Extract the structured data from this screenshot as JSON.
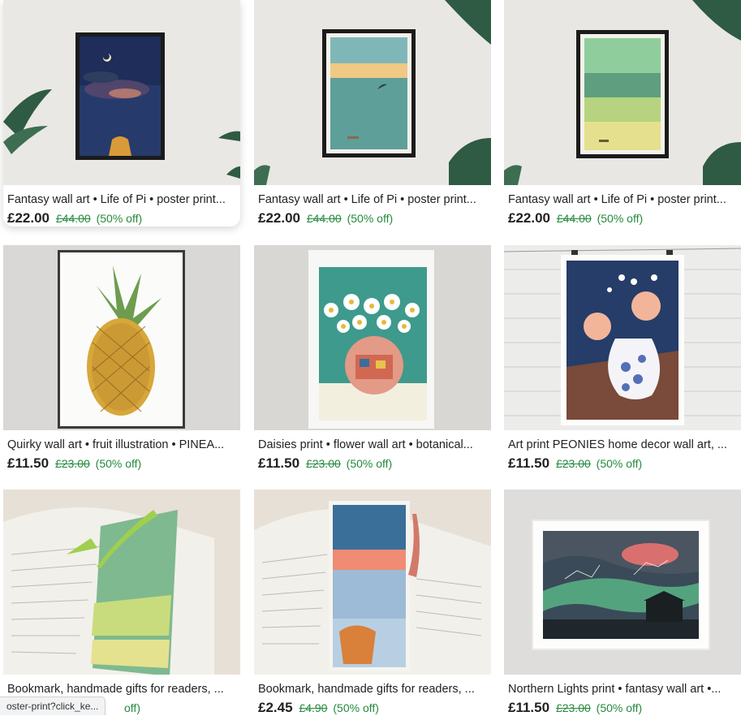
{
  "listings": [
    {
      "title": "Fantasy wall art • Life of Pi • poster print...",
      "price": "£22.00",
      "original_price": "£44.00",
      "discount": "(50% off)"
    },
    {
      "title": "Fantasy wall art • Life of Pi • poster print...",
      "price": "£22.00",
      "original_price": "£44.00",
      "discount": "(50% off)"
    },
    {
      "title": "Fantasy wall art • Life of Pi • poster print...",
      "price": "£22.00",
      "original_price": "£44.00",
      "discount": "(50% off)"
    },
    {
      "title": "Quirky wall art • fruit illustration • PINEA...",
      "price": "£11.50",
      "original_price": "£23.00",
      "discount": "(50% off)"
    },
    {
      "title": "Daisies print • flower wall art • botanical...",
      "price": "£11.50",
      "original_price": "£23.00",
      "discount": "(50% off)"
    },
    {
      "title": "Art print PEONIES home decor wall art, ...",
      "price": "£11.50",
      "original_price": "£23.00",
      "discount": "(50% off)"
    },
    {
      "title": "Bookmark, handmade gifts for readers, ...",
      "price": "",
      "original_price": "",
      "discount": "off)"
    },
    {
      "title": "Bookmark, handmade gifts for readers, ...",
      "price": "£2.45",
      "original_price": "£4.90",
      "discount": "(50% off)"
    },
    {
      "title": "Northern Lights print • fantasy wall art •...",
      "price": "£11.50",
      "original_price": "£23.00",
      "discount": "(50% off)"
    }
  ],
  "status_bar": {
    "url": "oster-print?click_ke..."
  },
  "colors": {
    "discount_green": "#248a3d",
    "text": "#222222"
  }
}
